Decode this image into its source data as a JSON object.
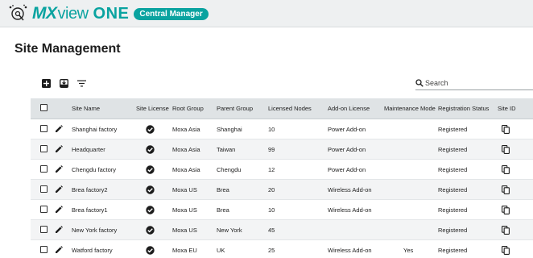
{
  "app": {
    "brand_mx": "MX",
    "brand_view": "view",
    "brand_one": "ONE",
    "badge": "Central Manager",
    "accent": "#0aa3a0"
  },
  "page": {
    "title": "Site Management"
  },
  "toolbar": {
    "icons": [
      "add-icon",
      "import-icon",
      "filter-icon"
    ]
  },
  "search": {
    "placeholder": "Search",
    "value": ""
  },
  "table": {
    "columns": [
      "Site Name",
      "Site License",
      "Root Group",
      "Parent Group",
      "Licensed Nodes",
      "Add-on License",
      "Maintenance Mode",
      "Registration Status",
      "Site ID"
    ],
    "rows": [
      {
        "name": "Shanghai factory",
        "root": "Moxa Asia",
        "parent": "Shanghai",
        "nodes": "10",
        "addon": "Power Add-on",
        "maint": "",
        "reg": "Registered"
      },
      {
        "name": "Headquarter",
        "root": "Moxa Asia",
        "parent": "Taiwan",
        "nodes": "99",
        "addon": "Power Add-on",
        "maint": "",
        "reg": "Registered"
      },
      {
        "name": "Chengdu factory",
        "root": "Moxa Asia",
        "parent": "Chengdu",
        "nodes": "12",
        "addon": "Power Add-on",
        "maint": "",
        "reg": "Registered"
      },
      {
        "name": "Brea factory2",
        "root": "Moxa US",
        "parent": "Brea",
        "nodes": "20",
        "addon": "Wireless Add-on",
        "maint": "",
        "reg": "Registered"
      },
      {
        "name": "Brea factory1",
        "root": "Moxa US",
        "parent": "Brea",
        "nodes": "10",
        "addon": "Wireless Add-on",
        "maint": "",
        "reg": "Registered"
      },
      {
        "name": "New York factory",
        "root": "Moxa US",
        "parent": "New York",
        "nodes": "45",
        "addon": "",
        "maint": "",
        "reg": "Registered"
      },
      {
        "name": "Watford factory",
        "root": "Moxa EU",
        "parent": "UK",
        "nodes": "25",
        "addon": "Wireless Add-on",
        "maint": "Yes",
        "reg": "Registered"
      }
    ]
  }
}
